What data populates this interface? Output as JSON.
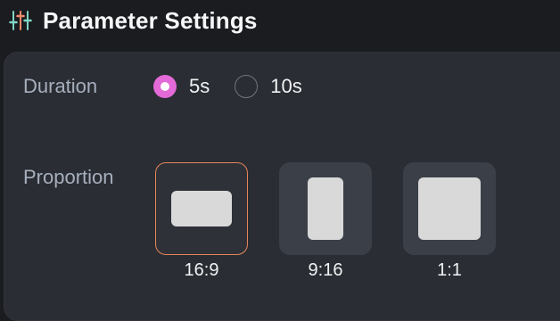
{
  "header": {
    "title": "Parameter Settings",
    "icon": "sliders-icon"
  },
  "duration": {
    "label": "Duration",
    "options": [
      {
        "label": "5s",
        "selected": true
      },
      {
        "label": "10s",
        "selected": false
      }
    ]
  },
  "proportion": {
    "label": "Proportion",
    "options": [
      {
        "label": "16:9",
        "selected": true
      },
      {
        "label": "9:16",
        "selected": false
      },
      {
        "label": "1:1",
        "selected": false
      }
    ]
  },
  "colors": {
    "accent_radio": "#e46ad8",
    "accent_selected_border": "#e5845c",
    "icon_teal": "#7fd6c6",
    "icon_coral": "#f08a6c"
  }
}
